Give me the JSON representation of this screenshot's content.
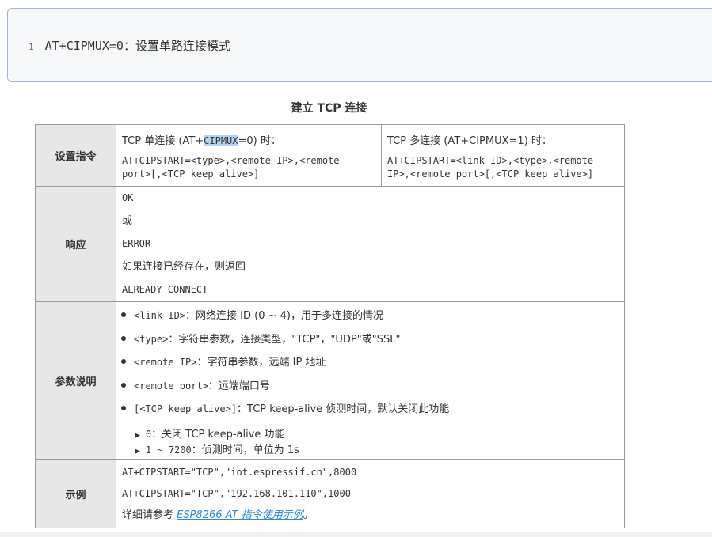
{
  "code_block": {
    "line_number": "1",
    "text": "AT+CIPMUX=0：设置单路连接模式"
  },
  "caption": "建立 TCP 连接",
  "table": {
    "set_command": {
      "header": "设置指令",
      "single": {
        "title_prefix": "TCP 单连接 (AT+",
        "title_highlight": "CIPMUX",
        "title_suffix": "=0) 时：",
        "line1": "AT+CIPSTART=<type>,<remote IP>,<remote",
        "line2": "port>[,<TCP keep alive>]"
      },
      "multi": {
        "title": "TCP 多连接 (AT+CIPMUX=1) 时：",
        "line1": "AT+CIPSTART=<link ID>,<type>,<remote",
        "line2": "IP>,<remote port>[,<TCP keep alive>]"
      }
    },
    "response": {
      "header": "响应",
      "lines": [
        "OK",
        "或",
        "ERROR",
        "如果连接已经存在，则返回",
        "ALREADY CONNECT"
      ]
    },
    "params": {
      "header": "参数说明",
      "items": [
        {
          "code": "<link ID>",
          "desc": "：网络连接 ID (0 ~ 4)，用于多连接的情况"
        },
        {
          "code": "<type>",
          "desc": "：字符串参数，连接类型，\"TCP\"，\"UDP\"或\"SSL\""
        },
        {
          "code": "<remote IP>",
          "desc": "：字符串参数，远端 IP 地址"
        },
        {
          "code": "<remote port>",
          "desc": "：远端端口号"
        },
        {
          "code": "[<TCP keep alive>]",
          "desc": "：TCP keep-alive 侦测时间，默认关闭此功能"
        }
      ],
      "sub_items": [
        {
          "code": "0",
          "desc": "：关闭 TCP keep-alive 功能"
        },
        {
          "code": "1 ~ 7200",
          "desc": "：侦测时间，单位为 1s"
        }
      ]
    },
    "example": {
      "header": "示例",
      "line1": "AT+CIPSTART=\"TCP\",\"iot.espressif.cn\",8000",
      "line2": "AT+CIPSTART=\"TCP\",\"192.168.101.110\",1000",
      "ref_prefix": "详细请参考 ",
      "ref_link": "ESP8266 AT 指令使用示例",
      "ref_suffix": "。"
    }
  }
}
